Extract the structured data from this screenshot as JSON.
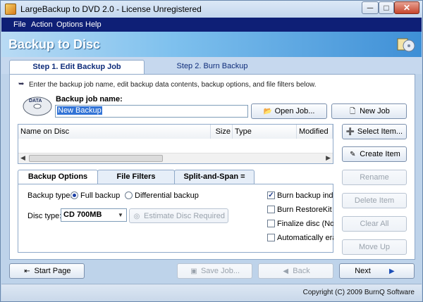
{
  "window": {
    "title": "LargeBackup to DVD 2.0 - License Unregistered",
    "minimize": "─",
    "maximize": "□",
    "close": "✕"
  },
  "menu": [
    "File",
    "Action",
    "Options",
    "Help"
  ],
  "banner": {
    "title": "Backup to Disc"
  },
  "steps": [
    {
      "label": "Step 1. Edit Backup Job"
    },
    {
      "label": "Step 2. Burn Backup"
    }
  ],
  "intro": "Enter the backup job name, edit backup data contents, backup options, and file filters below.",
  "disc_icon_text": "DATA",
  "job": {
    "label": "Backup job name:",
    "value": "New Backup",
    "open_label": "Open Job...",
    "new_label": "New Job"
  },
  "file_list": {
    "columns": [
      "Name on Disc",
      "Size",
      "Type",
      "Modified"
    ],
    "rows": []
  },
  "side_buttons": {
    "select": "Select Item...",
    "create": "Create Item",
    "rename": "Rename",
    "delete": "Delete Item",
    "clear": "Clear All",
    "moveup": "Move Up"
  },
  "option_tabs": [
    "Backup Options",
    "File Filters",
    "Split-and-Span = OFF"
  ],
  "options": {
    "backup_type_label": "Backup type:",
    "full_backup": "Full backup",
    "differential_backup": "Differential backup",
    "backup_type_selected": "Full backup",
    "disc_type_label": "Disc type:",
    "disc_type_value": "CD 700MB",
    "estimate_label": "Estimate Disc Required",
    "checks": [
      {
        "label": "Burn backup index c",
        "checked": true
      },
      {
        "label": "Burn RestoreKit Inst",
        "checked": false
      },
      {
        "label": "Finalize disc (No furt",
        "checked": false
      },
      {
        "label": "Automatically erase",
        "checked": false
      }
    ]
  },
  "nav": {
    "start": "Start Page",
    "save": "Save Job...",
    "back": "Back",
    "next": "Next"
  },
  "status": {
    "copyright": "Copyright (C) 2009 BurnQ Software"
  }
}
